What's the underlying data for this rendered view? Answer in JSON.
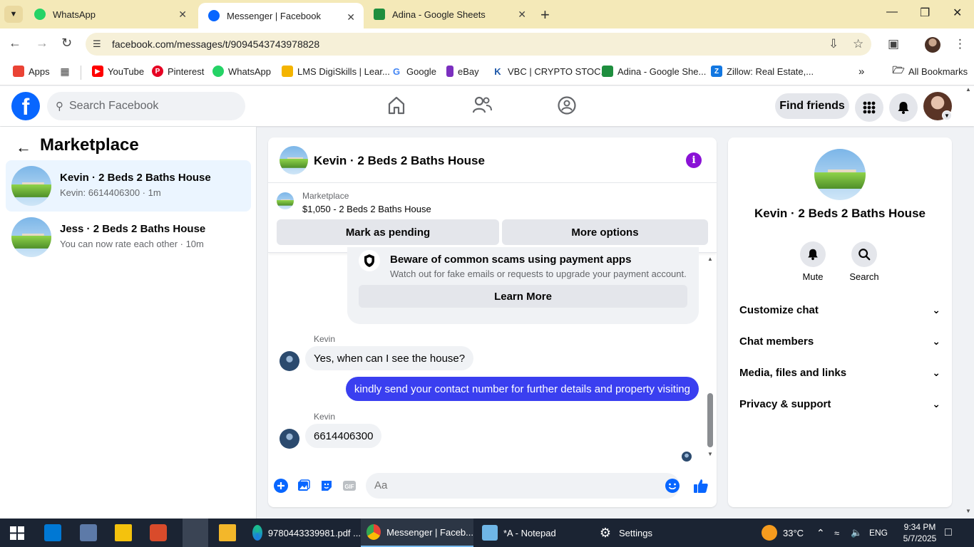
{
  "browser": {
    "tabs": [
      {
        "label": "WhatsApp",
        "icon": "whatsapp-icon"
      },
      {
        "label": "Messenger | Facebook",
        "icon": "facebook-icon"
      },
      {
        "label": "Adina - Google Sheets",
        "icon": "sheets-icon"
      }
    ],
    "url": "facebook.com/messages/t/9094543743978828",
    "bookmarks": [
      {
        "label": "Apps"
      },
      {
        "label": "YouTube"
      },
      {
        "label": "Pinterest"
      },
      {
        "label": "WhatsApp"
      },
      {
        "label": "LMS DigiSkills | Lear..."
      },
      {
        "label": "Google"
      },
      {
        "label": "eBay"
      },
      {
        "label": "VBC | CRYPTO STOC..."
      },
      {
        "label": "Adina - Google She..."
      },
      {
        "label": "Zillow: Real Estate,..."
      }
    ],
    "all_bookmarks": "All Bookmarks"
  },
  "facebook": {
    "search_placeholder": "Search Facebook",
    "find_friends": "Find friends"
  },
  "left": {
    "title": "Marketplace",
    "conversations": [
      {
        "name": "Kevin · 2 Beds 2 Baths House",
        "preview": "Kevin: 6614406300 · 1m"
      },
      {
        "name": "Jess · 2 Beds 2 Baths House",
        "preview": "You can now rate each other · 10m"
      }
    ]
  },
  "chat": {
    "title": "Kevin · 2 Beds 2 Baths House",
    "marketplace_label": "Marketplace",
    "listing": "$1,050 - 2 Beds 2 Baths House",
    "mark_pending": "Mark as pending",
    "more_options": "More options",
    "scam_title": "Beware of common scams using payment apps",
    "scam_sub": "Watch out for fake emails or requests to upgrade your payment account.",
    "learn_more": "Learn More",
    "messages": [
      {
        "sender": "Kevin",
        "text": "Yes, when can I see the house?"
      },
      {
        "text": "kindly send your contact number for further details and property visiting"
      },
      {
        "sender": "Kevin",
        "text": "6614406300"
      }
    ],
    "input_placeholder": "Aa"
  },
  "right": {
    "title": "Kevin · 2 Beds 2 Baths House",
    "mute": "Mute",
    "search": "Search",
    "sections": [
      "Customize chat",
      "Chat members",
      "Media, files and links",
      "Privacy & support"
    ]
  },
  "taskbar": {
    "apps": [
      "9780443339981.pdf ...",
      "Messenger | Faceb...",
      "*A - Notepad",
      "Settings"
    ],
    "temperature": "33°C",
    "language": "ENG",
    "time": "9:34 PM",
    "date": "5/7/2025"
  },
  "colors": {
    "facebook_blue": "#0866ff",
    "outgoing_bubble": "#3a3ff0",
    "info_purple": "#8a12d6",
    "active_conv_bg": "#ebf5ff"
  }
}
